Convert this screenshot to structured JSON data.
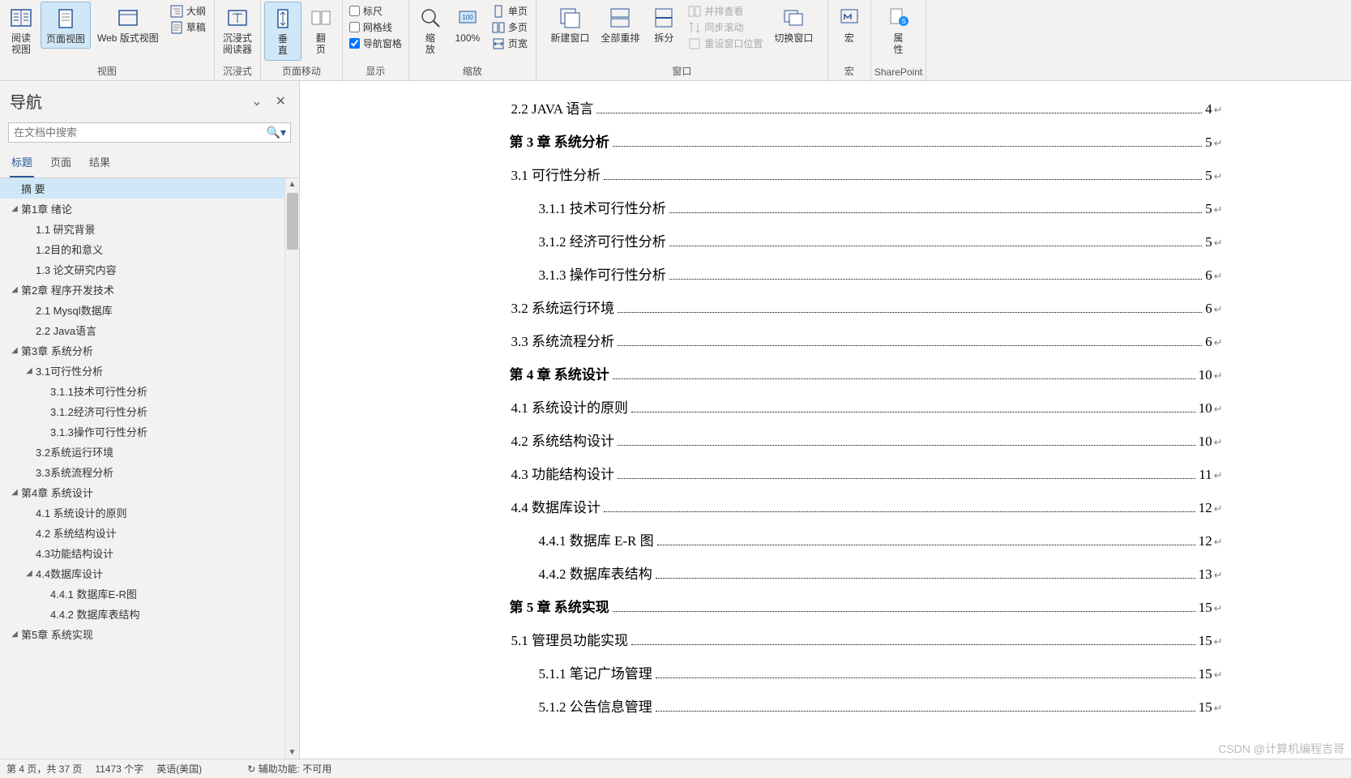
{
  "ribbon": {
    "groups": {
      "view": {
        "label": "视图",
        "read_view": "阅读\n视图",
        "page_view": "页面视图",
        "web_view": "Web 版式视图",
        "outline": "大纲",
        "draft": "草稿"
      },
      "immersive": {
        "label": "沉浸式",
        "reader": "沉浸式\n阅读器"
      },
      "page_move": {
        "label": "页面移动",
        "vertical": "垂\n直",
        "flip": "翻\n页"
      },
      "show": {
        "label": "显示",
        "ruler": "标尺",
        "gridlines": "网格线",
        "nav_pane": "导航窗格"
      },
      "zoom": {
        "label": "缩放",
        "zoom": "缩\n放",
        "hundred": "100%",
        "one_page": "单页",
        "multi_page": "多页",
        "page_width": "页宽"
      },
      "window": {
        "label": "窗口",
        "new_win": "新建窗口",
        "arrange_all": "全部重排",
        "split": "拆分",
        "side_by_side": "并排查看",
        "sync_scroll": "同步滚动",
        "reset_pos": "重设窗口位置",
        "switch_win": "切换窗口"
      },
      "macros": {
        "label": "宏",
        "macro": "宏"
      },
      "sharepoint": {
        "label": "SharePoint",
        "props": "属\n性"
      }
    }
  },
  "nav": {
    "title": "导航",
    "search_placeholder": "在文档中搜索",
    "tabs": {
      "headings": "标题",
      "pages": "页面",
      "results": "结果"
    },
    "tree": [
      {
        "depth": 0,
        "caret": false,
        "label": "摘  要",
        "selected": true
      },
      {
        "depth": 0,
        "caret": true,
        "label": "第1章 绪论"
      },
      {
        "depth": 1,
        "caret": false,
        "label": "1.1 研究背景"
      },
      {
        "depth": 1,
        "caret": false,
        "label": "1.2目的和意义"
      },
      {
        "depth": 1,
        "caret": false,
        "label": "1.3 论文研究内容"
      },
      {
        "depth": 0,
        "caret": true,
        "label": "第2章 程序开发技术"
      },
      {
        "depth": 1,
        "caret": false,
        "label": "2.1 Mysql数据库"
      },
      {
        "depth": 1,
        "caret": false,
        "label": "2.2 Java语言"
      },
      {
        "depth": 0,
        "caret": true,
        "label": "第3章 系统分析"
      },
      {
        "depth": 1,
        "caret": true,
        "label": "3.1可行性分析"
      },
      {
        "depth": 2,
        "caret": false,
        "label": "3.1.1技术可行性分析"
      },
      {
        "depth": 2,
        "caret": false,
        "label": "3.1.2经济可行性分析"
      },
      {
        "depth": 2,
        "caret": false,
        "label": "3.1.3操作可行性分析"
      },
      {
        "depth": 1,
        "caret": false,
        "label": "3.2系统运行环境"
      },
      {
        "depth": 1,
        "caret": false,
        "label": "3.3系统流程分析"
      },
      {
        "depth": 0,
        "caret": true,
        "label": "第4章 系统设计"
      },
      {
        "depth": 1,
        "caret": false,
        "label": "4.1 系统设计的原则"
      },
      {
        "depth": 1,
        "caret": false,
        "label": "4.2 系统结构设计"
      },
      {
        "depth": 1,
        "caret": false,
        "label": "4.3功能结构设计"
      },
      {
        "depth": 1,
        "caret": true,
        "label": "4.4数据库设计"
      },
      {
        "depth": 2,
        "caret": false,
        "label": "4.4.1 数据库E-R图"
      },
      {
        "depth": 2,
        "caret": false,
        "label": "4.4.2 数据库表结构"
      },
      {
        "depth": 0,
        "caret": true,
        "label": "第5章 系统实现"
      }
    ]
  },
  "toc": [
    {
      "level": 1,
      "title": "2.2 JAVA 语言",
      "page": "4",
      "sc": true
    },
    {
      "level": 0,
      "title": "第 3 章  系统分析",
      "page": "5",
      "bold": true
    },
    {
      "level": 1,
      "title": "3.1 可行性分析",
      "page": "5"
    },
    {
      "level": 2,
      "title": "3.1.1 技术可行性分析",
      "page": "5"
    },
    {
      "level": 2,
      "title": "3.1.2 经济可行性分析",
      "page": "5"
    },
    {
      "level": 2,
      "title": "3.1.3 操作可行性分析",
      "page": "6"
    },
    {
      "level": 1,
      "title": "3.2 系统运行环境",
      "page": "6"
    },
    {
      "level": 1,
      "title": "3.3 系统流程分析",
      "page": "6"
    },
    {
      "level": 0,
      "title": "第 4 章  系统设计",
      "page": "10",
      "bold": true
    },
    {
      "level": 1,
      "title": "4.1 系统设计的原则",
      "page": "10"
    },
    {
      "level": 1,
      "title": "4.2 系统结构设计",
      "page": "10"
    },
    {
      "level": 1,
      "title": "4.3 功能结构设计",
      "page": "11"
    },
    {
      "level": 1,
      "title": "4.4 数据库设计",
      "page": "12"
    },
    {
      "level": 2,
      "title": "4.4.1  数据库 E-R 图",
      "page": "12"
    },
    {
      "level": 2,
      "title": "4.4.2 数据库表结构",
      "page": "13"
    },
    {
      "level": 0,
      "title": "第 5 章  系统实现",
      "page": "15",
      "bold": true
    },
    {
      "level": 1,
      "title": "5.1 管理员功能实现",
      "page": "15"
    },
    {
      "level": 2,
      "title": "5.1.1 笔记广场管理",
      "page": "15"
    },
    {
      "level": 2,
      "title": "5.1.2 公告信息管理",
      "page": "15"
    }
  ],
  "status": {
    "page": "第 4 页，共 37 页",
    "words": "11473 个字",
    "lang": "英语(美国)",
    "a11y": "辅助功能: 不可用"
  },
  "watermark": "CSDN @计算机编程吉哥"
}
